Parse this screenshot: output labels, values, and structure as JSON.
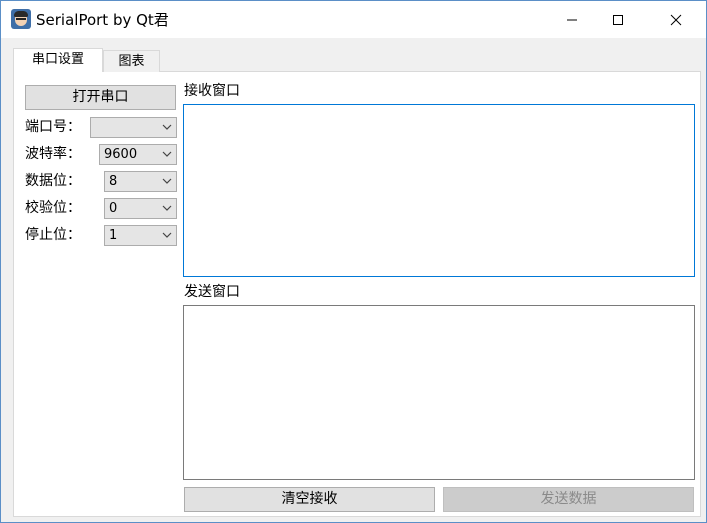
{
  "window": {
    "title": "SerialPort by Qt君",
    "icon": "app-avatar-icon",
    "border_color": "#5b8fc7"
  },
  "titlebar_controls": {
    "minimize_icon": "minimize-icon",
    "maximize_icon": "maximize-icon",
    "close_icon": "close-icon"
  },
  "tabs": [
    {
      "label": "串口设置",
      "active": true
    },
    {
      "label": "图表",
      "active": false
    }
  ],
  "settings": {
    "open_port_label": "打开串口",
    "fields": [
      {
        "label": "端口号：",
        "value": ""
      },
      {
        "label": "波特率：",
        "value": "9600"
      },
      {
        "label": "数据位：",
        "value": "8"
      },
      {
        "label": "校验位：",
        "value": "0"
      },
      {
        "label": "停止位：",
        "value": "1"
      }
    ]
  },
  "receive": {
    "label": "接收窗口",
    "content": "",
    "focus_color": "#0078d7"
  },
  "send": {
    "label": "发送窗口",
    "content": ""
  },
  "actions": {
    "clear_label": "清空接收",
    "send_label": "发送数据",
    "send_enabled": false
  }
}
